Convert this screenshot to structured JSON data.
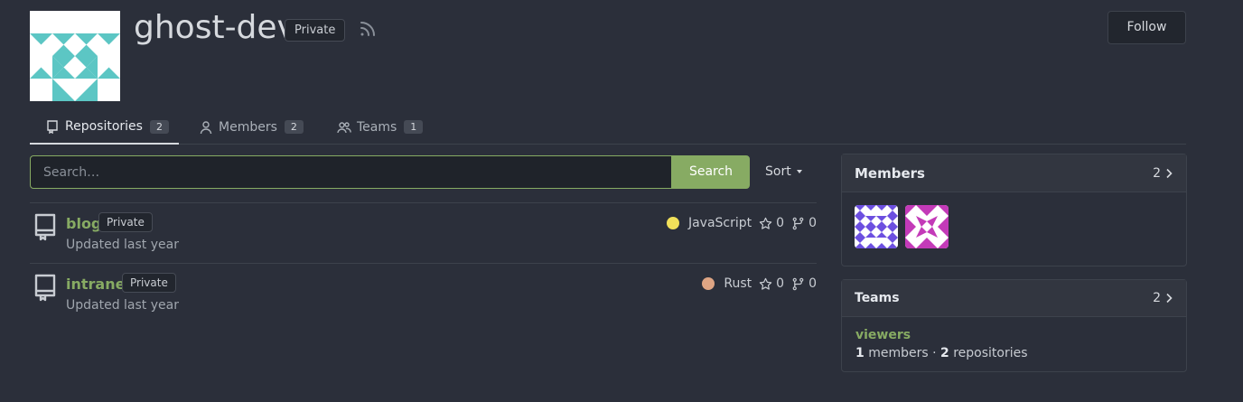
{
  "org": {
    "name": "ghost-dev",
    "visibility": "Private",
    "follow_label": "Follow"
  },
  "tabs": [
    {
      "label": "Repositories",
      "count": "2",
      "icon": "repo-icon"
    },
    {
      "label": "Members",
      "count": "2",
      "icon": "person-icon"
    },
    {
      "label": "Teams",
      "count": "1",
      "icon": "people-icon"
    }
  ],
  "search": {
    "placeholder": "Search…",
    "button_label": "Search",
    "sort_label": "Sort"
  },
  "repos": [
    {
      "name": "blog",
      "visibility": "Private",
      "updated": "Updated last year",
      "language": "JavaScript",
      "language_color": "#f1e05a",
      "stars": "0",
      "forks": "0"
    },
    {
      "name": "intranet",
      "visibility": "Private",
      "updated": "Updated last year",
      "language": "Rust",
      "language_color": "#dea584",
      "stars": "0",
      "forks": "0"
    }
  ],
  "members_panel": {
    "title": "Members",
    "count": "2"
  },
  "teams_panel": {
    "title": "Teams",
    "count": "2",
    "team": {
      "name": "viewers",
      "members_count": "1",
      "members_label": " members · ",
      "repos_count": "2",
      "repos_label": " repositories"
    }
  },
  "colors": {
    "accent": "#87ab63",
    "background": "#2b2f3a",
    "panel_header": "#323640"
  }
}
